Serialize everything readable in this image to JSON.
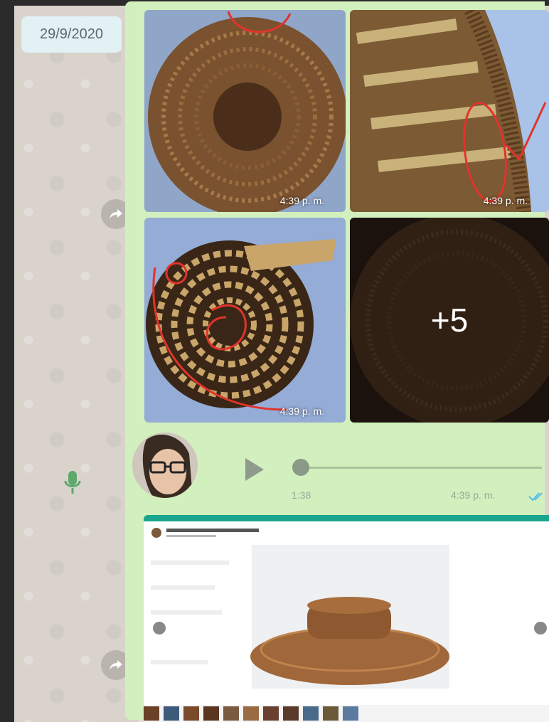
{
  "chat": {
    "date_chip": "29/9/2020",
    "album": {
      "photos": [
        {
          "time": "4:39 p. m."
        },
        {
          "time": "4:39 p. m."
        },
        {
          "time": "4:39 p. m."
        },
        {
          "more_count": "+5"
        }
      ]
    },
    "voice_note": {
      "duration": "1:38",
      "time": "4:39 p. m."
    },
    "colors": {
      "bubble": "#d2efbe",
      "ticks": "#53bdeb",
      "wallpaper": "#d9d3cc"
    }
  }
}
